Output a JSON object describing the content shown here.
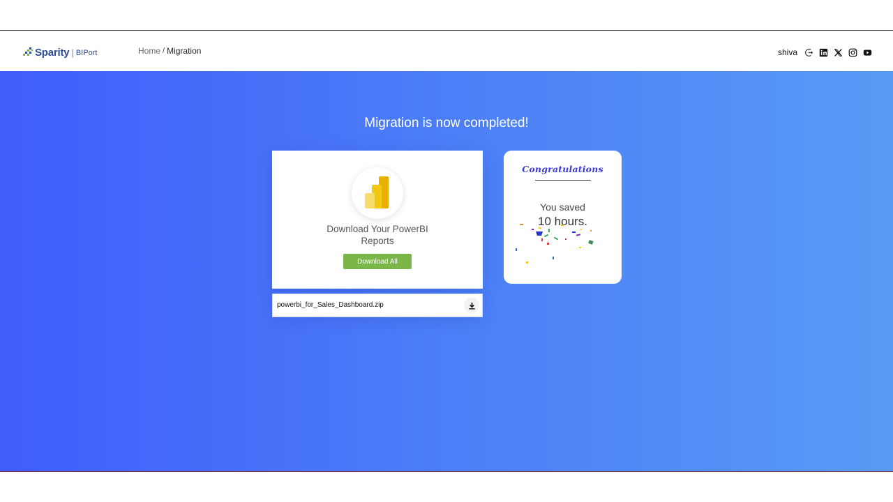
{
  "header": {
    "brand_name": "Sparity",
    "brand_separator": "|",
    "brand_sub": "BIPort",
    "breadcrumb": {
      "home": "Home",
      "separator": "/",
      "current": "Migration"
    },
    "username": "shiva",
    "icons": [
      "logout-icon",
      "linkedin-icon",
      "x-twitter-icon",
      "instagram-icon",
      "youtube-icon"
    ]
  },
  "main": {
    "title": "Migration is now completed!",
    "download_card": {
      "text_line1": "Download Your PowerBI",
      "text_line2": "Reports",
      "button_label": "Download All",
      "icon": "powerbi-logo-icon"
    },
    "file": {
      "name": "powerbi_for_Sales_Dashboard.zip",
      "icon": "download-icon"
    },
    "congrats_card": {
      "title": "Congratulations",
      "saved_label": "You saved",
      "saved_value": "10 hours."
    }
  },
  "colors": {
    "gradient_start": "#3f5dfb",
    "gradient_end": "#579bf5",
    "button_green": "#7ab648",
    "congrats_title": "#3b39d6",
    "brand": "#2b4a8f"
  }
}
